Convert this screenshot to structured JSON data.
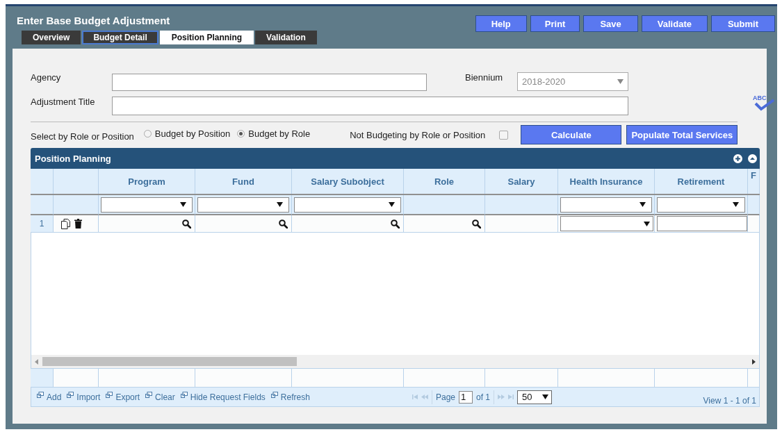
{
  "window": {
    "title": "Enter Base Budget Adjustment"
  },
  "header_buttons": [
    "Help",
    "Print",
    "Save",
    "Validate",
    "Submit"
  ],
  "tabs": [
    {
      "label": "Overview",
      "selected": false,
      "focused": false
    },
    {
      "label": "Budget Detail",
      "selected": false,
      "focused": true
    },
    {
      "label": "Position Planning",
      "selected": true,
      "focused": false
    },
    {
      "label": "Validation",
      "selected": false,
      "focused": false
    }
  ],
  "form": {
    "agency": {
      "label": "Agency"
    },
    "biennium": {
      "label": "Biennium",
      "value": "2018-2020",
      "disabled": true
    },
    "adjustment_title": {
      "label": "Adjustment Title"
    },
    "spellcheck": {
      "label": "ABC"
    },
    "selection": {
      "label": "Select by Role or Position",
      "options": [
        {
          "label": "Budget by Position",
          "selected": false
        },
        {
          "label": "Budget by Role",
          "selected": true
        }
      ]
    },
    "not_budgeting": {
      "label": "Not Budgeting by Role or Position",
      "checked": false
    },
    "action_buttons": [
      "Calculate",
      "Populate Total Services"
    ]
  },
  "grid": {
    "title": "Position Planning",
    "columns": [
      {
        "kind": "number",
        "filterable": false
      },
      {
        "kind": "actions",
        "filterable": false
      },
      {
        "label": "Program",
        "kind": "lookup",
        "filterable": true
      },
      {
        "label": "Fund",
        "kind": "lookup",
        "filterable": true
      },
      {
        "label": "Salary Subobject",
        "kind": "lookup",
        "filterable": true
      },
      {
        "label": "Role",
        "kind": "lookup",
        "filterable": false
      },
      {
        "label": "Salary",
        "kind": "text",
        "filterable": false
      },
      {
        "label": "Health Insurance",
        "kind": "select",
        "filterable": true
      },
      {
        "label": "Retirement",
        "kind": "input",
        "filterable": true
      },
      {
        "label": "F",
        "kind": "text",
        "filterable": false
      }
    ],
    "rows": [
      {
        "number": "1"
      }
    ],
    "footer_actions": [
      "Add",
      "Import",
      "Export",
      "Clear",
      "Hide Request Fields",
      "Refresh"
    ],
    "pager": {
      "page_label": "Page",
      "page": "1",
      "of": "of 1",
      "page_size": "50",
      "view": "View 1 - 1 of 1"
    }
  }
}
